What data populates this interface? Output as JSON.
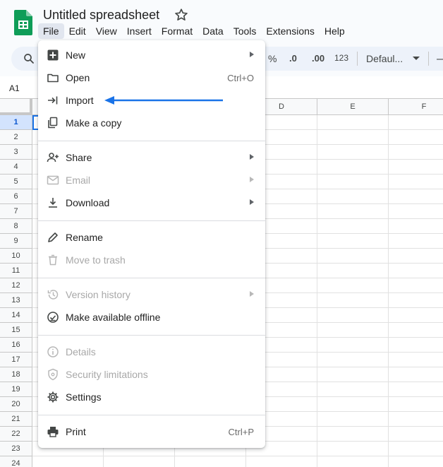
{
  "header": {
    "doc_title": "Untitled spreadsheet",
    "menus": [
      "File",
      "Edit",
      "View",
      "Insert",
      "Format",
      "Data",
      "Tools",
      "Extensions",
      "Help"
    ]
  },
  "toolbar": {
    "percent": "%",
    "dec_decrease": ".0",
    "dec_increase": ".00",
    "number_format": "123",
    "font": "Defaul...",
    "minus": "—"
  },
  "formula_bar": {
    "name_box": "A1"
  },
  "grid": {
    "columns": [
      "D",
      "E",
      "F"
    ],
    "rows": [
      "1",
      "2",
      "3",
      "4",
      "5",
      "6",
      "7",
      "8",
      "9",
      "10",
      "11",
      "12",
      "13",
      "14",
      "15",
      "16",
      "17",
      "18",
      "19",
      "20",
      "21",
      "22",
      "23",
      "24"
    ]
  },
  "file_menu": {
    "items": [
      {
        "label": "New",
        "shortcut": "",
        "icon": "plus-icon"
      },
      {
        "label": "Open",
        "shortcut": "Ctrl+O",
        "icon": "folder-icon"
      },
      {
        "label": "Import",
        "shortcut": "",
        "icon": "import-icon"
      },
      {
        "label": "Make a copy",
        "shortcut": "",
        "icon": "copy-icon"
      },
      {
        "label": "Share",
        "shortcut": "",
        "icon": "add-person-icon"
      },
      {
        "label": "Email",
        "shortcut": "",
        "icon": "mail-icon"
      },
      {
        "label": "Download",
        "shortcut": "",
        "icon": "download-icon"
      },
      {
        "label": "Rename",
        "shortcut": "",
        "icon": "pencil-icon"
      },
      {
        "label": "Move to trash",
        "shortcut": "",
        "icon": "trash-icon"
      },
      {
        "label": "Version history",
        "shortcut": "",
        "icon": "history-icon"
      },
      {
        "label": "Make available offline",
        "shortcut": "",
        "icon": "offline-icon"
      },
      {
        "label": "Details",
        "shortcut": "",
        "icon": "info-icon"
      },
      {
        "label": "Security limitations",
        "shortcut": "",
        "icon": "shield-icon"
      },
      {
        "label": "Settings",
        "shortcut": "",
        "icon": "gear-icon"
      },
      {
        "label": "Print",
        "shortcut": "Ctrl+P",
        "icon": "printer-icon"
      }
    ]
  },
  "colors": {
    "accent": "#1a73e8",
    "sheets_green": "#0f9d58",
    "disabled": "#a8a8a8"
  }
}
